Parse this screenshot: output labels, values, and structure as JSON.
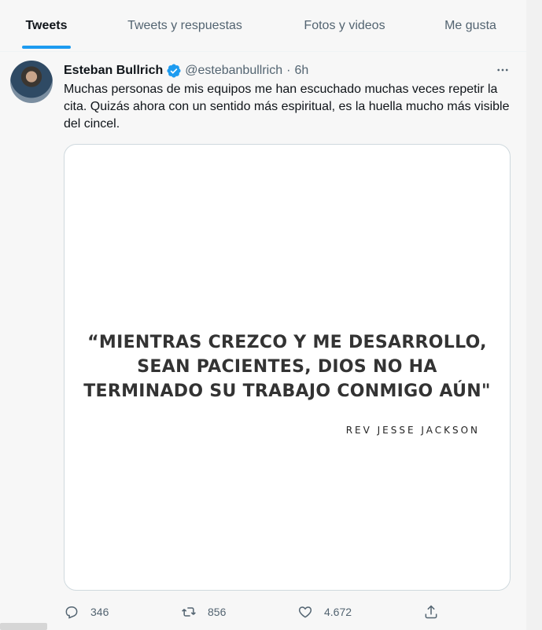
{
  "tabs": [
    {
      "label": "Tweets",
      "active": true
    },
    {
      "label": "Tweets y respuestas",
      "active": false
    },
    {
      "label": "Fotos y videos",
      "active": false
    },
    {
      "label": "Me gusta",
      "active": false
    }
  ],
  "tweet": {
    "author_name": "Esteban Bullrich",
    "handle": "@estebanbullrich",
    "separator": "·",
    "time": "6h",
    "verified": true,
    "text": "Muchas personas de mis equipos me han escuchado muchas veces repetir la cita. Quizás ahora con un sentido más espiritual, es la huella mucho más visible del cincel.",
    "media": {
      "quote": "“MIENTRAS CREZCO Y ME DESARROLLO, SEAN PACIENTES, DIOS NO HA TERMINADO SU TRABAJO CONMIGO AÚN\"",
      "author": "REV JESSE JACKSON"
    },
    "actions": {
      "replies": "346",
      "retweets": "856",
      "likes": "4.672"
    }
  },
  "colors": {
    "accent": "#1d9bf0",
    "text_secondary": "#536471",
    "text_primary": "#0f1419"
  },
  "icons": [
    "verified-badge-icon",
    "more-icon",
    "reply-icon",
    "retweet-icon",
    "like-icon",
    "share-icon"
  ]
}
